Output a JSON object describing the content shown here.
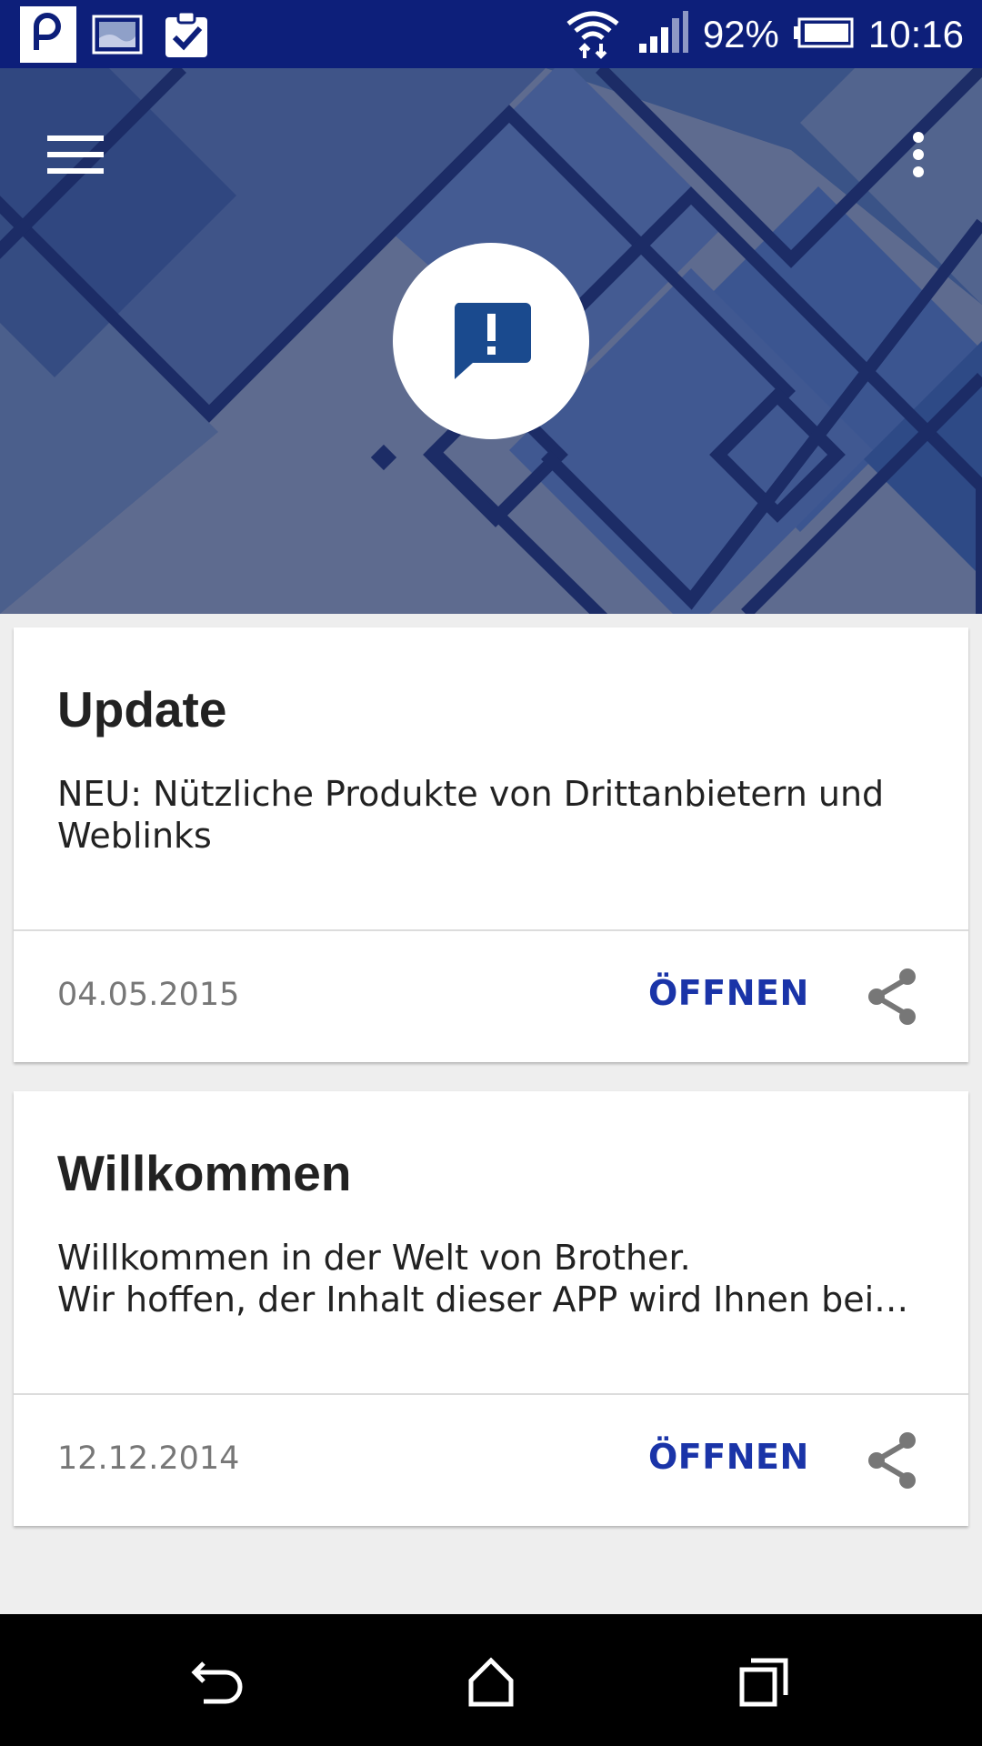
{
  "status_bar": {
    "battery_percent": "92%",
    "time": "10:16",
    "icons": [
      "app-p-icon",
      "gallery-icon",
      "clipboard-check-icon",
      "wifi-icon",
      "signal-icon",
      "battery-icon"
    ]
  },
  "header": {
    "menu_icon": "hamburger-menu-icon",
    "more_icon": "more-vert-icon",
    "badge_icon": "feedback-alert-icon"
  },
  "cards": [
    {
      "title": "Update",
      "text_lines": [
        "NEU: Nützliche Produkte von Drittanbietern und",
        "Weblinks"
      ],
      "date": "04.05.2015",
      "open_label": "ÖFFNEN",
      "share_icon": "share-icon"
    },
    {
      "title": "Willkommen",
      "text_lines": [
        "Willkommen in der Welt von Brother.",
        "Wir hoffen, der Inhalt dieser APP wird Ihnen beim…"
      ],
      "date": "12.12.2014",
      "open_label": "ÖFFNEN",
      "share_icon": "share-icon"
    }
  ],
  "nav_bar": {
    "icons": [
      "back-icon",
      "home-icon",
      "recents-icon"
    ]
  },
  "colors": {
    "status_bar": "#0d1f7a",
    "accent": "#1a34a8",
    "header_base": "#5e6b8f"
  }
}
